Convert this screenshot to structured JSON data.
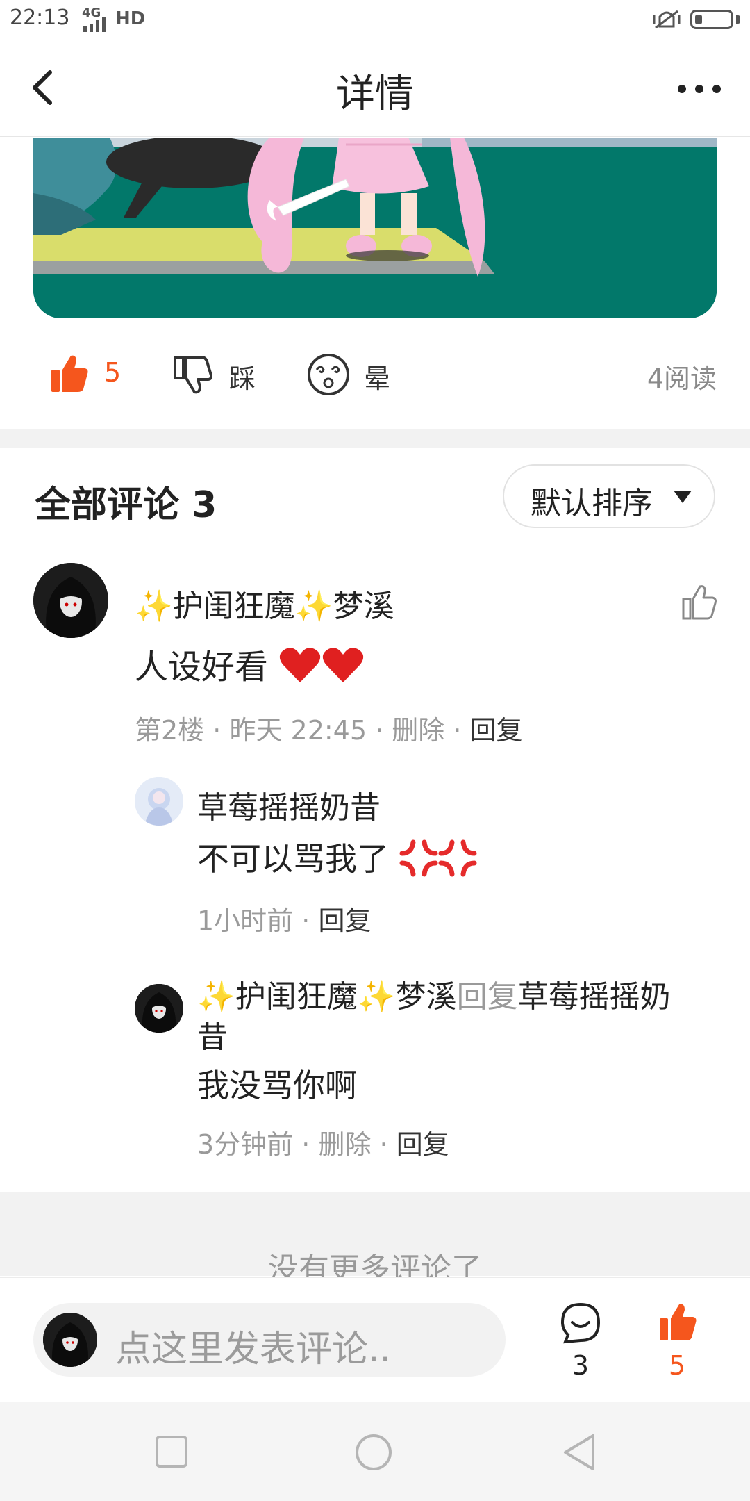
{
  "status_bar": {
    "time": "22:13",
    "network": "4G",
    "hd": "HD"
  },
  "header": {
    "title": "详情"
  },
  "reactions": {
    "like_count": "5",
    "dislike_label": "踩",
    "dizzy_label": "晕",
    "reads": "4阅读"
  },
  "comments": {
    "title": "全部评论 3",
    "sort_label": "默认排序",
    "items": [
      {
        "user": "护闺狂魔",
        "user2": "梦溪",
        "text": "人设好看",
        "floor": "第2楼",
        "time": "昨天 22:45",
        "delete": "删除",
        "reply": "回复",
        "replies": [
          {
            "user": "草莓摇摇奶昔",
            "text": "不可以骂我了",
            "time": "1小时前",
            "reply": "回复"
          },
          {
            "user": "护闺狂魔",
            "user2": "梦溪",
            "reply_word": "回复",
            "target_line1": "草莓摇摇奶",
            "target_line2": "昔",
            "text": "我没骂你啊",
            "time": "3分钟前",
            "delete": "删除",
            "reply": "回复"
          }
        ]
      }
    ]
  },
  "footer": {
    "no_more": "没有更多评论了"
  },
  "bottom_bar": {
    "placeholder": "点这里发表评论..",
    "comment_count": "3",
    "like_count": "5"
  },
  "colors": {
    "accent": "#f5561d",
    "teal": "#02786a",
    "pink": "#f7c1dd",
    "sparkle": "#f2c500",
    "heart": "#e02020"
  }
}
